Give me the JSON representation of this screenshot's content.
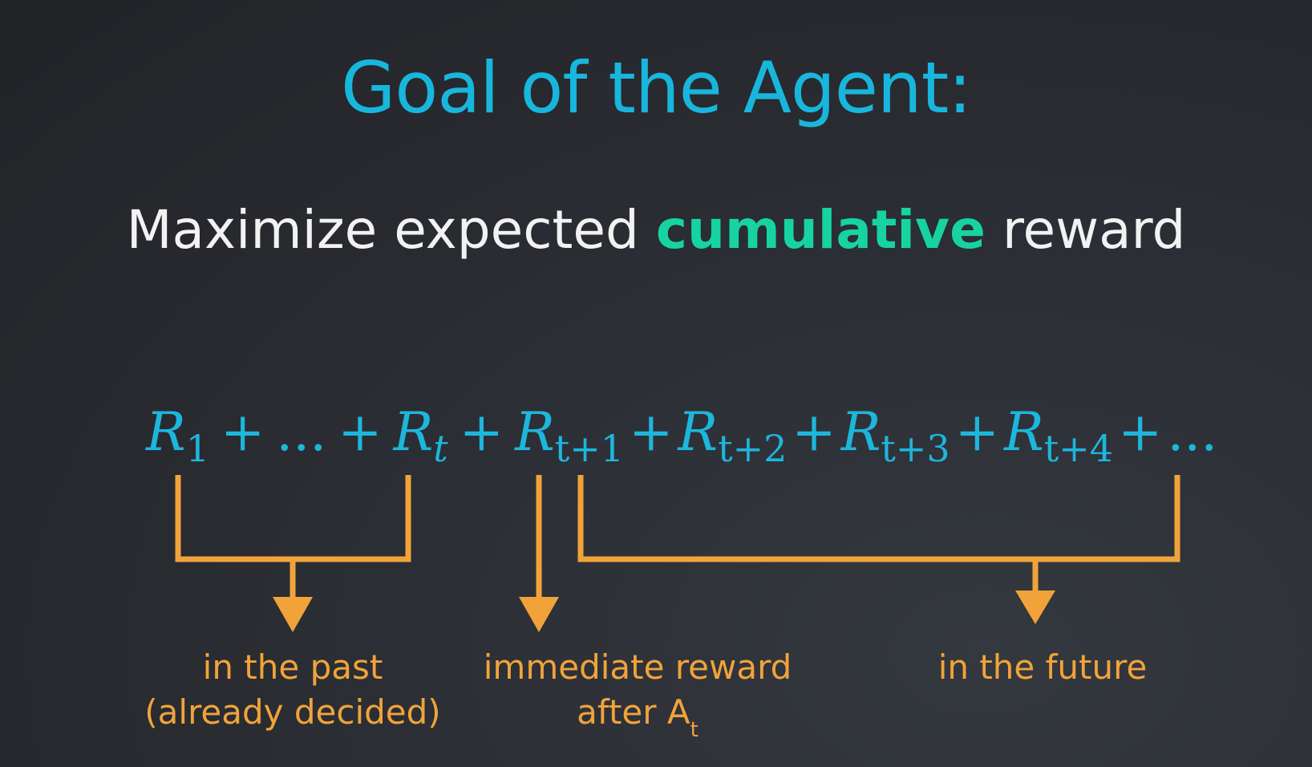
{
  "title": "Goal of the Agent:",
  "subtitle": {
    "before": "Maximize expected",
    "highlight": "cumulative",
    "after": "reward"
  },
  "equation": {
    "terms": [
      {
        "var": "R",
        "sub": "1"
      },
      {
        "op": "+"
      },
      {
        "ellipsis": "..."
      },
      {
        "op": "+"
      },
      {
        "var": "R",
        "sub": "t"
      },
      {
        "op": "+"
      },
      {
        "var": "R",
        "sub": "t+1"
      },
      {
        "op": "+"
      },
      {
        "var": "R",
        "sub": "t+2"
      },
      {
        "op": "+"
      },
      {
        "var": "R",
        "sub": "t+3"
      },
      {
        "op": "+"
      },
      {
        "var": "R",
        "sub": "t+4"
      },
      {
        "op": "+"
      },
      {
        "ellipsis": "..."
      }
    ]
  },
  "labels": {
    "past_line1": "in the past",
    "past_line2": "(already decided)",
    "immediate_line1": "immediate reward",
    "immediate_line2_prefix": "after A",
    "immediate_line2_sub": "t",
    "future": "in the future"
  },
  "colors": {
    "title": "#18b6dd",
    "highlight": "#17d3a2",
    "equation": "#1db6dc",
    "annotation": "#f1a33a",
    "background": "#2b2e34"
  }
}
